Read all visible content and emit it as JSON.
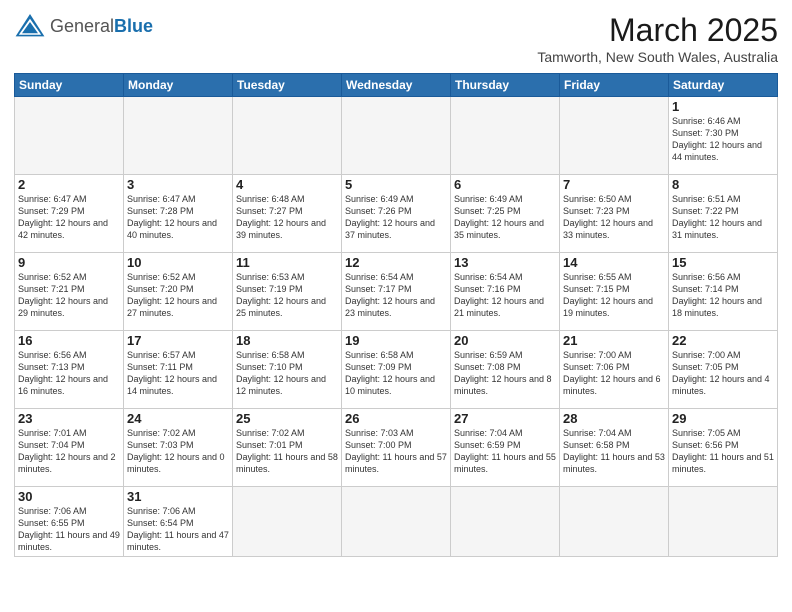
{
  "logo": {
    "text_general": "General",
    "text_blue": "Blue"
  },
  "header": {
    "month_title": "March 2025",
    "location": "Tamworth, New South Wales, Australia"
  },
  "weekdays": [
    "Sunday",
    "Monday",
    "Tuesday",
    "Wednesday",
    "Thursday",
    "Friday",
    "Saturday"
  ],
  "weeks": [
    [
      {
        "day": "",
        "empty": true
      },
      {
        "day": "",
        "empty": true
      },
      {
        "day": "",
        "empty": true
      },
      {
        "day": "",
        "empty": true
      },
      {
        "day": "",
        "empty": true
      },
      {
        "day": "",
        "empty": true
      },
      {
        "day": "1",
        "sunrise": "Sunrise: 6:46 AM",
        "sunset": "Sunset: 7:30 PM",
        "daylight": "Daylight: 12 hours and 44 minutes."
      }
    ],
    [
      {
        "day": "2",
        "sunrise": "Sunrise: 6:47 AM",
        "sunset": "Sunset: 7:29 PM",
        "daylight": "Daylight: 12 hours and 42 minutes."
      },
      {
        "day": "3",
        "sunrise": "Sunrise: 6:47 AM",
        "sunset": "Sunset: 7:28 PM",
        "daylight": "Daylight: 12 hours and 40 minutes."
      },
      {
        "day": "4",
        "sunrise": "Sunrise: 6:48 AM",
        "sunset": "Sunset: 7:27 PM",
        "daylight": "Daylight: 12 hours and 39 minutes."
      },
      {
        "day": "5",
        "sunrise": "Sunrise: 6:49 AM",
        "sunset": "Sunset: 7:26 PM",
        "daylight": "Daylight: 12 hours and 37 minutes."
      },
      {
        "day": "6",
        "sunrise": "Sunrise: 6:49 AM",
        "sunset": "Sunset: 7:25 PM",
        "daylight": "Daylight: 12 hours and 35 minutes."
      },
      {
        "day": "7",
        "sunrise": "Sunrise: 6:50 AM",
        "sunset": "Sunset: 7:23 PM",
        "daylight": "Daylight: 12 hours and 33 minutes."
      },
      {
        "day": "8",
        "sunrise": "Sunrise: 6:51 AM",
        "sunset": "Sunset: 7:22 PM",
        "daylight": "Daylight: 12 hours and 31 minutes."
      }
    ],
    [
      {
        "day": "9",
        "sunrise": "Sunrise: 6:52 AM",
        "sunset": "Sunset: 7:21 PM",
        "daylight": "Daylight: 12 hours and 29 minutes."
      },
      {
        "day": "10",
        "sunrise": "Sunrise: 6:52 AM",
        "sunset": "Sunset: 7:20 PM",
        "daylight": "Daylight: 12 hours and 27 minutes."
      },
      {
        "day": "11",
        "sunrise": "Sunrise: 6:53 AM",
        "sunset": "Sunset: 7:19 PM",
        "daylight": "Daylight: 12 hours and 25 minutes."
      },
      {
        "day": "12",
        "sunrise": "Sunrise: 6:54 AM",
        "sunset": "Sunset: 7:17 PM",
        "daylight": "Daylight: 12 hours and 23 minutes."
      },
      {
        "day": "13",
        "sunrise": "Sunrise: 6:54 AM",
        "sunset": "Sunset: 7:16 PM",
        "daylight": "Daylight: 12 hours and 21 minutes."
      },
      {
        "day": "14",
        "sunrise": "Sunrise: 6:55 AM",
        "sunset": "Sunset: 7:15 PM",
        "daylight": "Daylight: 12 hours and 19 minutes."
      },
      {
        "day": "15",
        "sunrise": "Sunrise: 6:56 AM",
        "sunset": "Sunset: 7:14 PM",
        "daylight": "Daylight: 12 hours and 18 minutes."
      }
    ],
    [
      {
        "day": "16",
        "sunrise": "Sunrise: 6:56 AM",
        "sunset": "Sunset: 7:13 PM",
        "daylight": "Daylight: 12 hours and 16 minutes."
      },
      {
        "day": "17",
        "sunrise": "Sunrise: 6:57 AM",
        "sunset": "Sunset: 7:11 PM",
        "daylight": "Daylight: 12 hours and 14 minutes."
      },
      {
        "day": "18",
        "sunrise": "Sunrise: 6:58 AM",
        "sunset": "Sunset: 7:10 PM",
        "daylight": "Daylight: 12 hours and 12 minutes."
      },
      {
        "day": "19",
        "sunrise": "Sunrise: 6:58 AM",
        "sunset": "Sunset: 7:09 PM",
        "daylight": "Daylight: 12 hours and 10 minutes."
      },
      {
        "day": "20",
        "sunrise": "Sunrise: 6:59 AM",
        "sunset": "Sunset: 7:08 PM",
        "daylight": "Daylight: 12 hours and 8 minutes."
      },
      {
        "day": "21",
        "sunrise": "Sunrise: 7:00 AM",
        "sunset": "Sunset: 7:06 PM",
        "daylight": "Daylight: 12 hours and 6 minutes."
      },
      {
        "day": "22",
        "sunrise": "Sunrise: 7:00 AM",
        "sunset": "Sunset: 7:05 PM",
        "daylight": "Daylight: 12 hours and 4 minutes."
      }
    ],
    [
      {
        "day": "23",
        "sunrise": "Sunrise: 7:01 AM",
        "sunset": "Sunset: 7:04 PM",
        "daylight": "Daylight: 12 hours and 2 minutes."
      },
      {
        "day": "24",
        "sunrise": "Sunrise: 7:02 AM",
        "sunset": "Sunset: 7:03 PM",
        "daylight": "Daylight: 12 hours and 0 minutes."
      },
      {
        "day": "25",
        "sunrise": "Sunrise: 7:02 AM",
        "sunset": "Sunset: 7:01 PM",
        "daylight": "Daylight: 11 hours and 58 minutes."
      },
      {
        "day": "26",
        "sunrise": "Sunrise: 7:03 AM",
        "sunset": "Sunset: 7:00 PM",
        "daylight": "Daylight: 11 hours and 57 minutes."
      },
      {
        "day": "27",
        "sunrise": "Sunrise: 7:04 AM",
        "sunset": "Sunset: 6:59 PM",
        "daylight": "Daylight: 11 hours and 55 minutes."
      },
      {
        "day": "28",
        "sunrise": "Sunrise: 7:04 AM",
        "sunset": "Sunset: 6:58 PM",
        "daylight": "Daylight: 11 hours and 53 minutes."
      },
      {
        "day": "29",
        "sunrise": "Sunrise: 7:05 AM",
        "sunset": "Sunset: 6:56 PM",
        "daylight": "Daylight: 11 hours and 51 minutes."
      }
    ],
    [
      {
        "day": "30",
        "sunrise": "Sunrise: 7:06 AM",
        "sunset": "Sunset: 6:55 PM",
        "daylight": "Daylight: 11 hours and 49 minutes."
      },
      {
        "day": "31",
        "sunrise": "Sunrise: 7:06 AM",
        "sunset": "Sunset: 6:54 PM",
        "daylight": "Daylight: 11 hours and 47 minutes."
      },
      {
        "day": "",
        "empty": true
      },
      {
        "day": "",
        "empty": true
      },
      {
        "day": "",
        "empty": true
      },
      {
        "day": "",
        "empty": true
      },
      {
        "day": "",
        "empty": true
      }
    ]
  ]
}
